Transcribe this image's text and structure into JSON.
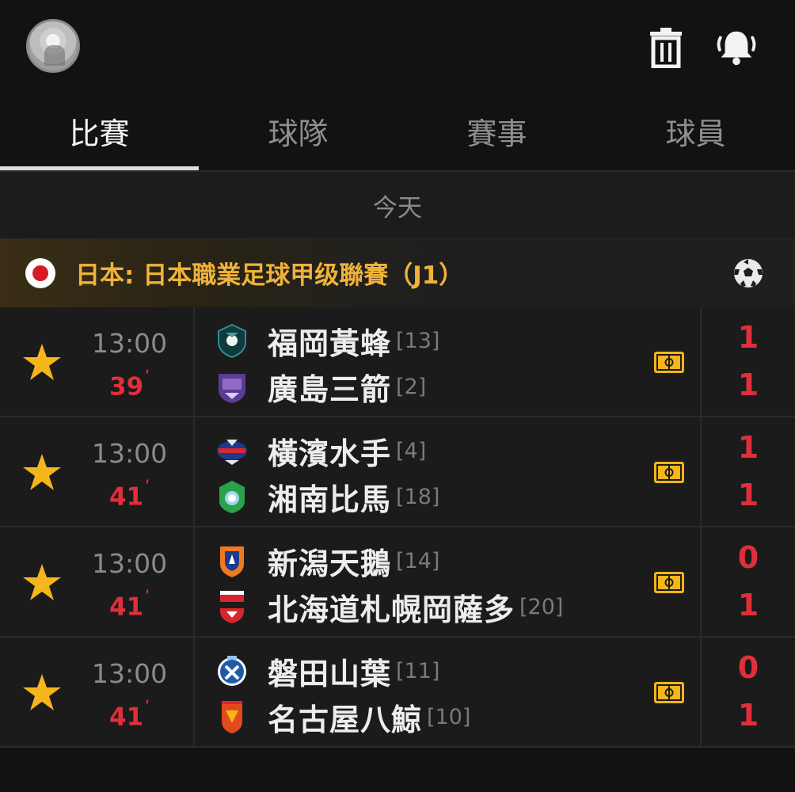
{
  "tabs": [
    {
      "label": "比賽"
    },
    {
      "label": "球隊"
    },
    {
      "label": "賽事"
    },
    {
      "label": "球員"
    }
  ],
  "date_label": "今天",
  "league": {
    "name": "日本: 日本職業足球甲级聯賽（J1）"
  },
  "colors": {
    "accent": "#f0b23a",
    "live": "#e02f3a",
    "star": "#f5b51b"
  },
  "matches": [
    {
      "time": "13:00",
      "minute": "39",
      "home": {
        "name": "福岡黃蜂",
        "rank": "[13]",
        "score": "1"
      },
      "away": {
        "name": "廣島三箭",
        "rank": "[2]",
        "score": "1"
      }
    },
    {
      "time": "13:00",
      "minute": "41",
      "home": {
        "name": "橫濱水手",
        "rank": "[4]",
        "score": "1"
      },
      "away": {
        "name": "湘南比馬",
        "rank": "[18]",
        "score": "1"
      }
    },
    {
      "time": "13:00",
      "minute": "41",
      "home": {
        "name": "新潟天鵝",
        "rank": "[14]",
        "score": "0"
      },
      "away": {
        "name": "北海道札幌岡薩多",
        "rank": "[20]",
        "score": "1"
      }
    },
    {
      "time": "13:00",
      "minute": "41",
      "home": {
        "name": "磐田山葉",
        "rank": "[11]",
        "score": "0"
      },
      "away": {
        "name": "名古屋八鯨",
        "rank": "[10]",
        "score": "1"
      }
    }
  ]
}
